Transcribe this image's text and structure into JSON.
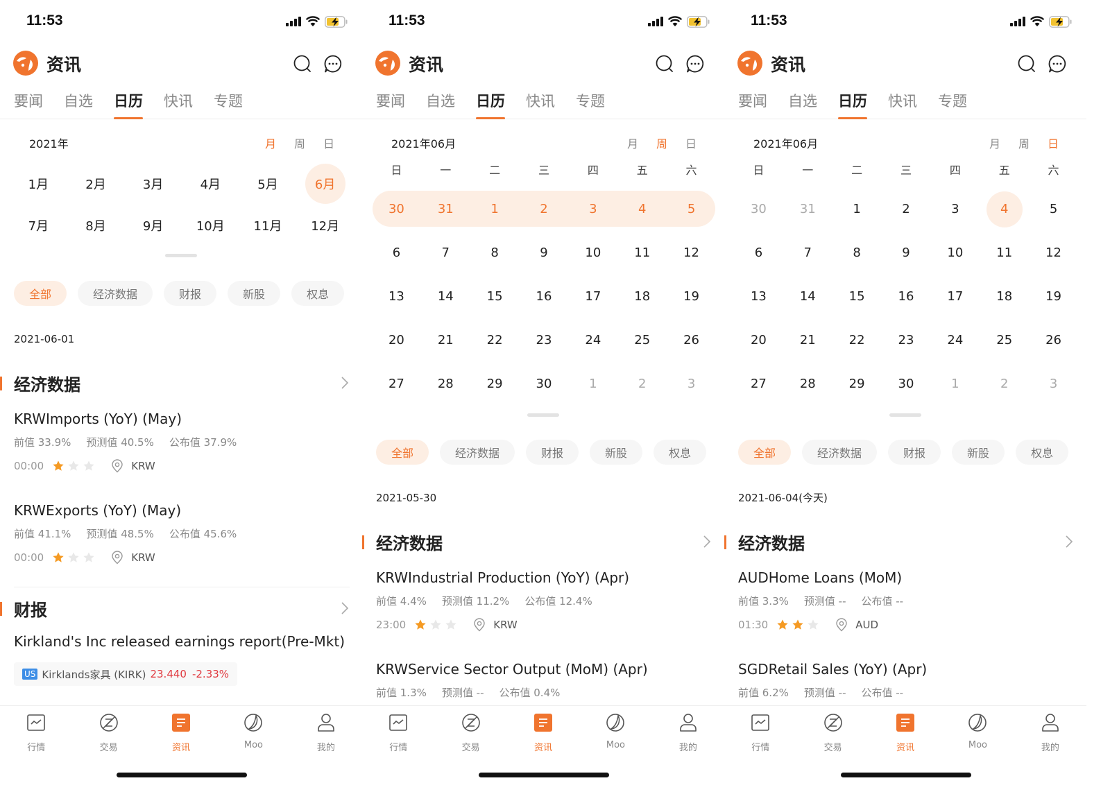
{
  "colors": {
    "accent": "#f0742e",
    "accent_light": "#fdeee3",
    "down_red": "#e0383e",
    "market_badge": "#3d8ee6"
  },
  "status_bar": {
    "time": "11:53",
    "icons": [
      "signal-icon",
      "wifi-icon",
      "battery-charging-icon"
    ]
  },
  "header": {
    "title": "资讯",
    "icons": [
      "app-logo",
      "search-icon",
      "message-icon"
    ]
  },
  "tabs": [
    {
      "label": "要闻",
      "active": false
    },
    {
      "label": "自选",
      "active": false
    },
    {
      "label": "日历",
      "active": true
    },
    {
      "label": "快讯",
      "active": false
    },
    {
      "label": "专题",
      "active": false
    }
  ],
  "view_modes": [
    "月",
    "周",
    "日"
  ],
  "filters": [
    {
      "label": "全部",
      "active": true
    },
    {
      "label": "经济数据",
      "active": false
    },
    {
      "label": "财报",
      "active": false
    },
    {
      "label": "新股",
      "active": false
    },
    {
      "label": "权息",
      "active": false
    }
  ],
  "weekdays": [
    "日",
    "一",
    "二",
    "三",
    "四",
    "五",
    "六"
  ],
  "nav": [
    {
      "label": "行情",
      "icon": "chart-icon",
      "active": false
    },
    {
      "label": "交易",
      "icon": "trade-icon",
      "active": false
    },
    {
      "label": "资讯",
      "icon": "news-icon",
      "active": true
    },
    {
      "label": "Moo",
      "icon": "moo-icon",
      "active": false
    },
    {
      "label": "我的",
      "icon": "profile-icon",
      "active": false
    }
  ],
  "screens": [
    {
      "mode": "月",
      "period_label": "2021年",
      "months": [
        {
          "label": "1月"
        },
        {
          "label": "2月"
        },
        {
          "label": "3月"
        },
        {
          "label": "4月"
        },
        {
          "label": "5月"
        },
        {
          "label": "6月",
          "selected": true
        },
        {
          "label": "7月"
        },
        {
          "label": "8月"
        },
        {
          "label": "9月"
        },
        {
          "label": "10月"
        },
        {
          "label": "11月"
        },
        {
          "label": "12月"
        }
      ],
      "date_label": "2021-06-01",
      "sections": [
        {
          "name": "经济数据",
          "items": [
            {
              "title": "KRWImports (YoY) (May)",
              "prev": "前值 33.9%",
              "forecast": "预测值 40.5%",
              "actual": "公布值 37.9%",
              "time": "00:00",
              "stars": 1,
              "country": "KRW"
            },
            {
              "title": "KRWExports (YoY) (May)",
              "prev": "前值 41.1%",
              "forecast": "预测值 48.5%",
              "actual": "公布值 45.6%",
              "time": "00:00",
              "stars": 1,
              "country": "KRW"
            }
          ]
        },
        {
          "name": "财报",
          "earnings": {
            "title": "Kirkland's Inc  released earnings report(Pre-Mkt)",
            "market": "US",
            "stock": "Kirklands家具 (KIRK)",
            "price": "23.440",
            "change": "-2.33%"
          }
        }
      ]
    },
    {
      "mode": "周",
      "period_label": "2021年06月",
      "days": [
        {
          "d": "30",
          "w": 1
        },
        {
          "d": "31",
          "w": 1
        },
        {
          "d": "1",
          "w": 1
        },
        {
          "d": "2",
          "w": 1
        },
        {
          "d": "3",
          "w": 1
        },
        {
          "d": "4",
          "w": 1
        },
        {
          "d": "5",
          "w": 1
        },
        {
          "d": "6"
        },
        {
          "d": "7"
        },
        {
          "d": "8"
        },
        {
          "d": "9"
        },
        {
          "d": "10"
        },
        {
          "d": "11"
        },
        {
          "d": "12"
        },
        {
          "d": "13"
        },
        {
          "d": "14"
        },
        {
          "d": "15"
        },
        {
          "d": "16"
        },
        {
          "d": "17"
        },
        {
          "d": "18"
        },
        {
          "d": "19"
        },
        {
          "d": "20"
        },
        {
          "d": "21"
        },
        {
          "d": "22"
        },
        {
          "d": "23"
        },
        {
          "d": "24"
        },
        {
          "d": "25"
        },
        {
          "d": "26"
        },
        {
          "d": "27"
        },
        {
          "d": "28"
        },
        {
          "d": "29"
        },
        {
          "d": "30"
        },
        {
          "d": "1",
          "dim": 1
        },
        {
          "d": "2",
          "dim": 1
        },
        {
          "d": "3",
          "dim": 1
        }
      ],
      "date_label": "2021-05-30",
      "sections": [
        {
          "name": "经济数据",
          "items": [
            {
              "title": "KRWIndustrial Production (YoY) (Apr)",
              "prev": "前值 4.4%",
              "forecast": "预测值 11.2%",
              "actual": "公布值 12.4%",
              "time": "23:00",
              "stars": 1,
              "country": "KRW"
            },
            {
              "title": "KRWService Sector Output (MoM) (Apr)",
              "prev": "前值 1.3%",
              "forecast": "预测值 --",
              "actual": "公布值 0.4%"
            }
          ]
        }
      ]
    },
    {
      "mode": "日",
      "period_label": "2021年06月",
      "days": [
        {
          "d": "30",
          "dim": 1
        },
        {
          "d": "31",
          "dim": 1
        },
        {
          "d": "1"
        },
        {
          "d": "2"
        },
        {
          "d": "3"
        },
        {
          "d": "4",
          "sel": 1
        },
        {
          "d": "5"
        },
        {
          "d": "6"
        },
        {
          "d": "7"
        },
        {
          "d": "8"
        },
        {
          "d": "9"
        },
        {
          "d": "10"
        },
        {
          "d": "11"
        },
        {
          "d": "12"
        },
        {
          "d": "13"
        },
        {
          "d": "14"
        },
        {
          "d": "15"
        },
        {
          "d": "16"
        },
        {
          "d": "17"
        },
        {
          "d": "18"
        },
        {
          "d": "19"
        },
        {
          "d": "20"
        },
        {
          "d": "21"
        },
        {
          "d": "22"
        },
        {
          "d": "23"
        },
        {
          "d": "24"
        },
        {
          "d": "25"
        },
        {
          "d": "26"
        },
        {
          "d": "27"
        },
        {
          "d": "28"
        },
        {
          "d": "29"
        },
        {
          "d": "30"
        },
        {
          "d": "1",
          "dim": 1
        },
        {
          "d": "2",
          "dim": 1
        },
        {
          "d": "3",
          "dim": 1
        }
      ],
      "date_label": "2021-06-04(今天)",
      "sections": [
        {
          "name": "经济数据",
          "items": [
            {
              "title": "AUDHome Loans (MoM)",
              "prev": "前值 3.3%",
              "forecast": "预测值 --",
              "actual": "公布值 --",
              "time": "01:30",
              "stars": 2,
              "country": "AUD"
            },
            {
              "title": "SGDRetail Sales (YoY) (Apr)",
              "prev": "前值 6.2%",
              "forecast": "预测值 --",
              "actual": "公布值 --"
            }
          ]
        }
      ]
    }
  ]
}
